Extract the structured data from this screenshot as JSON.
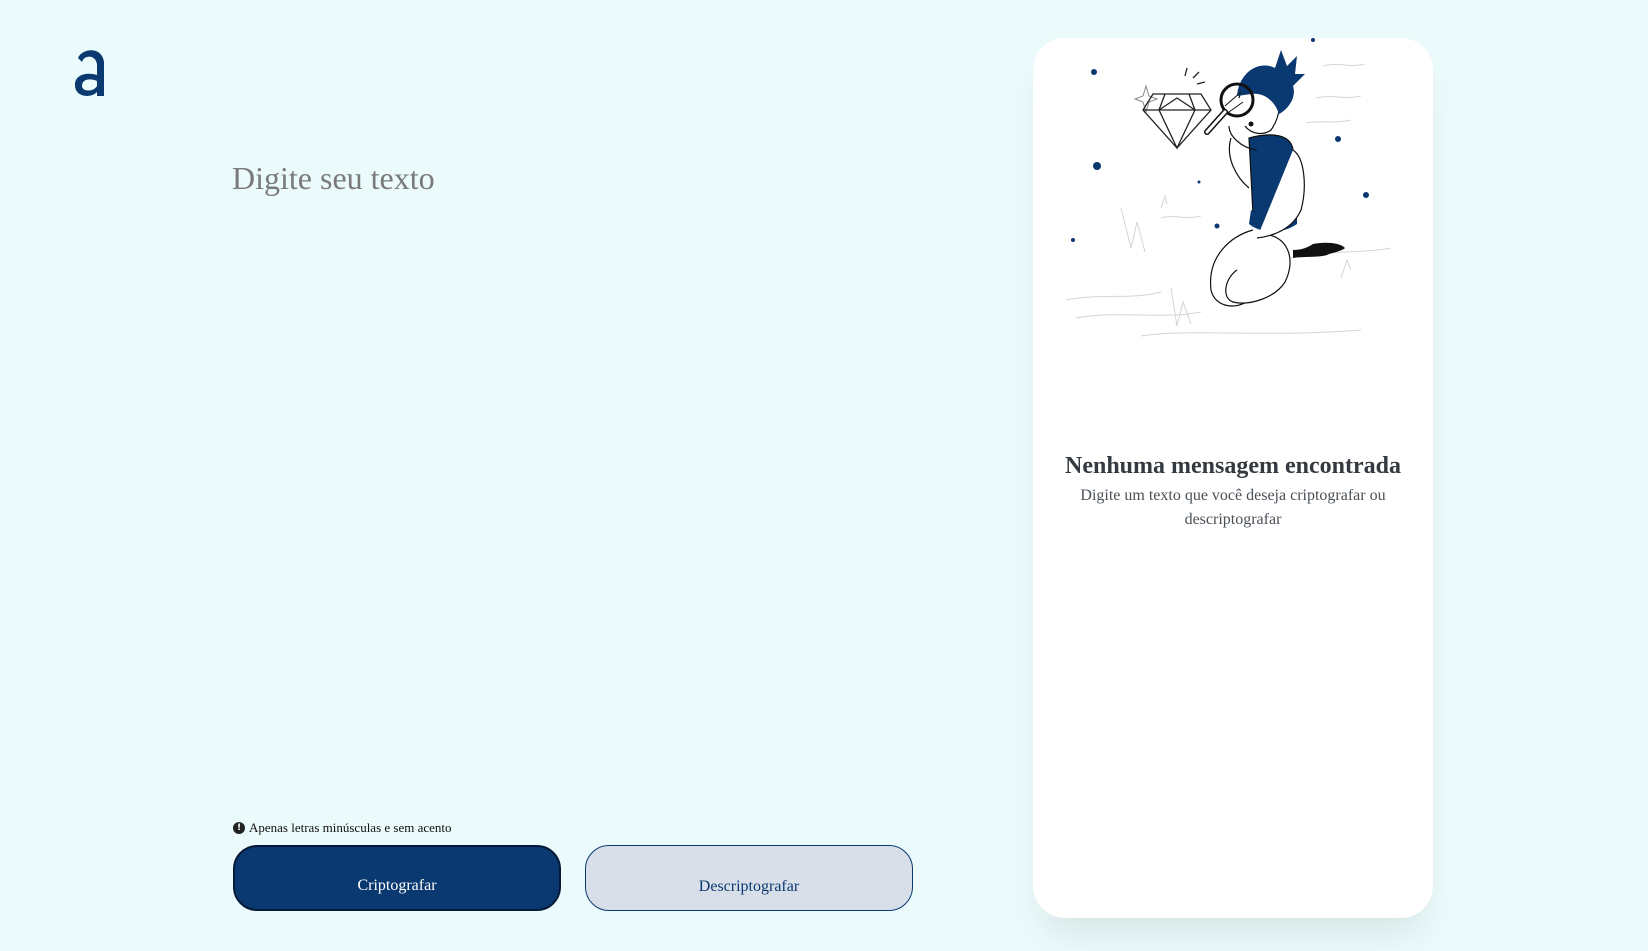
{
  "app": {
    "logo_letter": "a"
  },
  "input": {
    "placeholder": "Digite seu texto",
    "value": ""
  },
  "hint": {
    "icon": "info-icon",
    "icon_glyph": "!",
    "text": "Apenas letras minúsculas e sem acento"
  },
  "buttons": {
    "encrypt_label": "Criptografar",
    "decrypt_label": "Descriptografar"
  },
  "output": {
    "illustration": "person-with-magnifier-illustration",
    "title": "Nenhuma mensagem encontrada",
    "subtitle": "Digite um texto que você deseja criptografar ou descriptografar"
  },
  "colors": {
    "background": "#ebfafb",
    "accent": "#0a3871",
    "secondary_button": "#d8dfe9",
    "panel": "#ffffff"
  }
}
